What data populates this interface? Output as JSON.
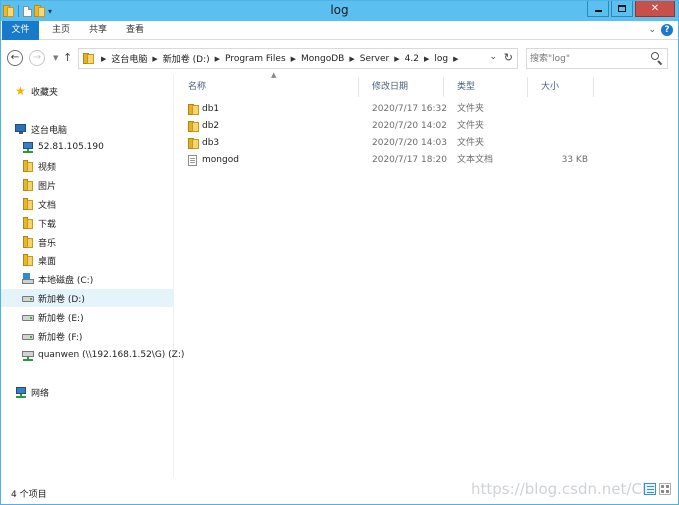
{
  "window": {
    "title": "log"
  },
  "ribbon": {
    "tabs": [
      {
        "label": "文件"
      },
      {
        "label": "主页"
      },
      {
        "label": "共享"
      },
      {
        "label": "查看"
      }
    ]
  },
  "address": {
    "crumbs": [
      "这台电脑",
      "新加卷 (D:)",
      "Program Files",
      "MongoDB",
      "Server",
      "4.2",
      "log"
    ]
  },
  "search": {
    "placeholder": "搜索\"log\""
  },
  "nav": {
    "items": [
      {
        "label": "收藏夹",
        "icon": "star-icon"
      },
      {
        "label": "这台电脑",
        "icon": "computer-icon"
      },
      {
        "label": "52.81.105.190",
        "icon": "network-location-icon"
      },
      {
        "label": "视频",
        "icon": "videos-library-icon"
      },
      {
        "label": "图片",
        "icon": "pictures-library-icon"
      },
      {
        "label": "文档",
        "icon": "documents-library-icon"
      },
      {
        "label": "下载",
        "icon": "downloads-library-icon"
      },
      {
        "label": "音乐",
        "icon": "music-library-icon"
      },
      {
        "label": "桌面",
        "icon": "desktop-library-icon"
      },
      {
        "label": "本地磁盘 (C:)",
        "icon": "system-drive-icon"
      },
      {
        "label": "新加卷 (D:)",
        "icon": "drive-icon",
        "selected": true
      },
      {
        "label": "新加卷 (E:)",
        "icon": "drive-icon"
      },
      {
        "label": "新加卷 (F:)",
        "icon": "drive-icon"
      },
      {
        "label": "quanwen (\\\\192.168.1.52\\G) (Z:)",
        "icon": "network-drive-icon"
      },
      {
        "label": "网络",
        "icon": "network-icon"
      }
    ]
  },
  "columns": {
    "name": "名称",
    "date": "修改日期",
    "type": "类型",
    "size": "大小"
  },
  "files": [
    {
      "name": "db1",
      "date": "2020/7/17 16:32",
      "type": "文件夹",
      "size": "",
      "icon": "folder-icon"
    },
    {
      "name": "db2",
      "date": "2020/7/20 14:02",
      "type": "文件夹",
      "size": "",
      "icon": "folder-icon"
    },
    {
      "name": "db3",
      "date": "2020/7/20 14:03",
      "type": "文件夹",
      "size": "",
      "icon": "folder-icon"
    },
    {
      "name": "mongod",
      "date": "2020/7/17 18:20",
      "type": "文本文档",
      "size": "33 KB",
      "icon": "text-file-icon"
    }
  ],
  "status": {
    "count": "4 个项目",
    "watermark": "https://blog.csdn.net/Ch"
  },
  "colors": {
    "titlebar": "#5bc0f0",
    "file_tab": "#1979ca",
    "close_button": "#c7504b",
    "selection": "#e5f3fb"
  }
}
